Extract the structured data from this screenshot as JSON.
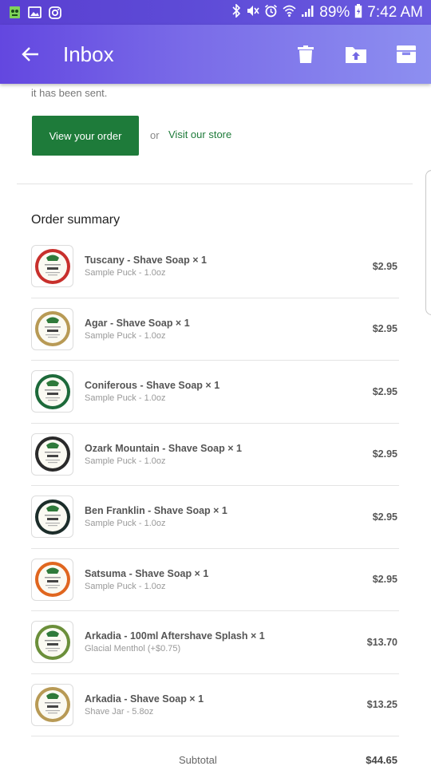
{
  "status_bar": {
    "battery": "89%",
    "time": "7:42 AM",
    "icons": [
      "app-icon",
      "image-icon",
      "instagram-icon",
      "bluetooth-icon",
      "mute-icon",
      "alarm-icon",
      "wifi-icon",
      "signal-icon",
      "battery-icon"
    ]
  },
  "app_bar": {
    "title": "Inbox",
    "actions": [
      "delete-icon",
      "move-to-icon",
      "archive-icon"
    ]
  },
  "email": {
    "sent_text": "it has been sent.",
    "view_order_label": "View your order",
    "or_text": "or",
    "store_link_label": "Visit our store",
    "summary_title": "Order summary",
    "items": [
      {
        "name": "Tuscany - Shave Soap × 1",
        "variant": "Sample Puck - 1.0oz",
        "price": "$2.95",
        "ring_color": "#c8302c"
      },
      {
        "name": "Agar - Shave Soap × 1",
        "variant": "Sample Puck - 1.0oz",
        "price": "$2.95",
        "ring_color": "#b89a55"
      },
      {
        "name": "Coniferous - Shave Soap × 1",
        "variant": "Sample Puck - 1.0oz",
        "price": "$2.95",
        "ring_color": "#1d6a3a"
      },
      {
        "name": "Ozark Mountain - Shave Soap × 1",
        "variant": "Sample Puck - 1.0oz",
        "price": "$2.95",
        "ring_color": "#2a2a2a"
      },
      {
        "name": "Ben Franklin - Shave Soap × 1",
        "variant": "Sample Puck - 1.0oz",
        "price": "$2.95",
        "ring_color": "#1c2d2a"
      },
      {
        "name": "Satsuma - Shave Soap × 1",
        "variant": "Sample Puck - 1.0oz",
        "price": "$2.95",
        "ring_color": "#e0661f"
      },
      {
        "name": "Arkadia - 100ml Aftershave Splash × 1",
        "variant": "Glacial Menthol (+$0.75)",
        "price": "$13.70",
        "ring_color": "#6b8f3a"
      },
      {
        "name": "Arkadia - Shave Soap × 1",
        "variant": "Shave Jar - 5.8oz",
        "price": "$13.25",
        "ring_color": "#b89a55"
      }
    ],
    "subtotal_label": "Subtotal",
    "subtotal_value": "$44.65"
  }
}
